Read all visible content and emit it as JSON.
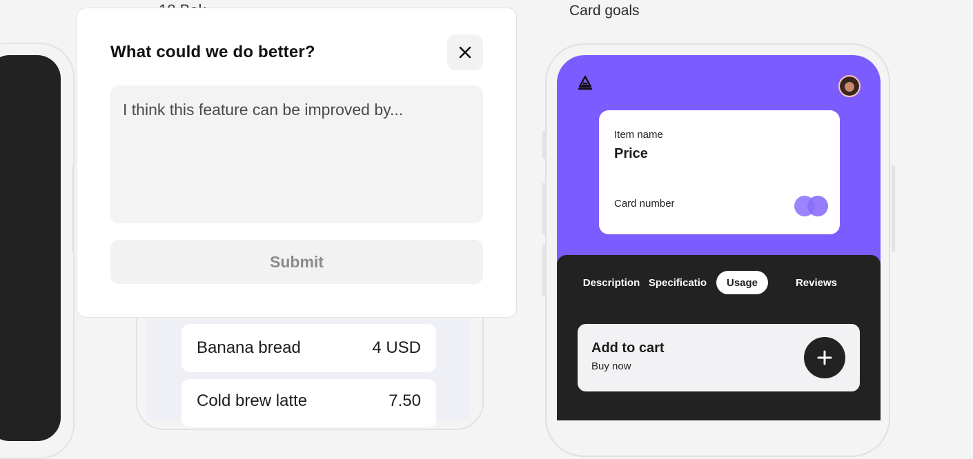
{
  "background_label": {
    "cut_text": "18 Bak"
  },
  "popup": {
    "title": "What could we do better?",
    "close_icon": "close-icon",
    "textarea_placeholder": "I think this feature can be improved by...",
    "submit_label": "Submit"
  },
  "menu": {
    "items": [
      {
        "name": "Banana bread",
        "price": "4 USD"
      },
      {
        "name": "Cold brew latte",
        "price": "7.50"
      }
    ]
  },
  "card_goals": {
    "section_label": "Card goals",
    "logo_icon": "brand-logo-icon",
    "avatar_icon": "user-avatar",
    "card": {
      "item_name": "Item name",
      "price": "Price",
      "card_number": "Card number"
    },
    "tabs": [
      {
        "label": "Description",
        "active": false
      },
      {
        "label": "Specificatio",
        "active": false
      },
      {
        "label": "Usage",
        "active": true
      },
      {
        "label": "Reviews",
        "active": false
      }
    ],
    "cart": {
      "title": "Add to cart",
      "subtitle": "Buy now",
      "button_icon": "plus-icon"
    }
  },
  "colors": {
    "accent": "#7b5cff",
    "dark": "#222222",
    "surface": "#f4f4f4"
  }
}
